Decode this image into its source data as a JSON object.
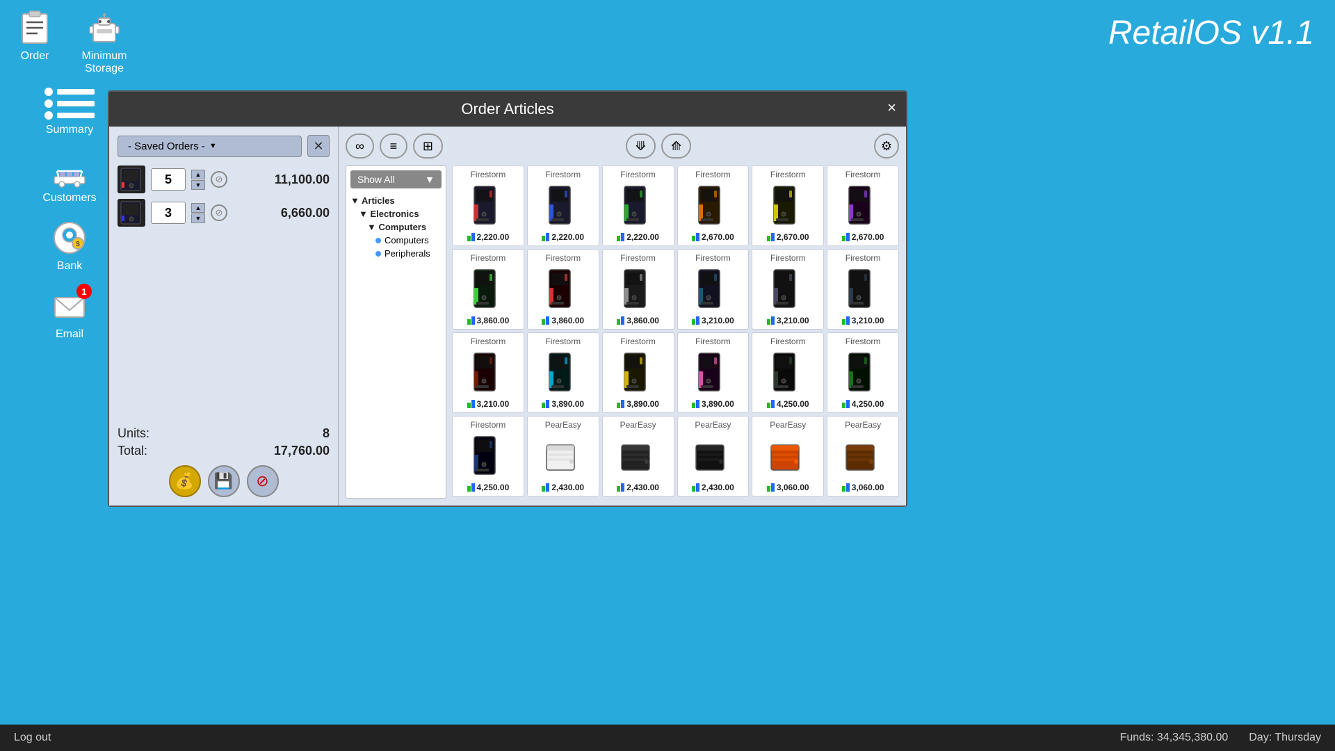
{
  "branding": {
    "title": "RetailOS v1.1"
  },
  "sidebar": {
    "order_label": "Order",
    "min_storage_label": "Minimum\nStorage",
    "summary_label": "Summary",
    "customers_label": "Customers",
    "bank_label": "Bank",
    "email_label": "Email",
    "email_badge": "1"
  },
  "dialog": {
    "title": "Order Articles",
    "close_label": "×",
    "saved_orders_label": "- Saved Orders -",
    "order_rows": [
      {
        "qty": "5",
        "price": "11,100.00"
      },
      {
        "qty": "3",
        "price": "6,660.00"
      }
    ],
    "units_label": "Units:",
    "units_value": "8",
    "total_label": "Total:",
    "total_value": "17,760.00"
  },
  "toolbar": {
    "infinity_label": "∞",
    "list_label": "≡",
    "grid_label": "⊞",
    "filter1_label": "⟱",
    "filter2_label": "⟰",
    "settings_label": "⚙"
  },
  "category": {
    "show_all": "Show All",
    "tree": [
      {
        "label": "Articles",
        "children": [
          {
            "label": "Electronics",
            "children": [
              {
                "label": "Computers",
                "children": [
                  {
                    "label": "Computers",
                    "type": "leaf"
                  },
                  {
                    "label": "Peripherals",
                    "type": "leaf"
                  }
                ]
              }
            ]
          }
        ]
      }
    ]
  },
  "products": [
    {
      "name": "Firestorm",
      "price": "2,220.00",
      "color": "red"
    },
    {
      "name": "Firestorm",
      "price": "2,220.00",
      "color": "blue"
    },
    {
      "name": "Firestorm",
      "price": "2,220.00",
      "color": "green"
    },
    {
      "name": "Firestorm",
      "price": "2,670.00",
      "color": "orange"
    },
    {
      "name": "Firestorm",
      "price": "2,670.00",
      "color": "yellow"
    },
    {
      "name": "Firestorm",
      "price": "2,670.00",
      "color": "purple"
    },
    {
      "name": "Firestorm",
      "price": "3,860.00",
      "color": "green2"
    },
    {
      "name": "Firestorm",
      "price": "3,860.00",
      "color": "red2"
    },
    {
      "name": "Firestorm",
      "price": "3,860.00",
      "color": "gray"
    },
    {
      "name": "Firestorm",
      "price": "3,210.00",
      "color": "dark"
    },
    {
      "name": "Firestorm",
      "price": "3,210.00",
      "color": "dark2"
    },
    {
      "name": "Firestorm",
      "price": "3,210.00",
      "color": "dark3"
    },
    {
      "name": "Firestorm",
      "price": "3,210.00",
      "color": "darkred"
    },
    {
      "name": "Firestorm",
      "price": "3,890.00",
      "color": "cyan"
    },
    {
      "name": "Firestorm",
      "price": "3,890.00",
      "color": "yellow2"
    },
    {
      "name": "Firestorm",
      "price": "3,890.00",
      "color": "pink"
    },
    {
      "name": "Firestorm",
      "price": "4,250.00",
      "color": "dark4"
    },
    {
      "name": "Firestorm",
      "price": "4,250.00",
      "color": "greenDark"
    },
    {
      "name": "Firestorm",
      "price": "4,250.00",
      "color": "blueDark"
    },
    {
      "name": "PearEasy",
      "price": "2,430.00",
      "color": "white"
    },
    {
      "name": "PearEasy",
      "price": "2,430.00",
      "color": "black"
    },
    {
      "name": "PearEasy",
      "price": "2,430.00",
      "color": "black2"
    },
    {
      "name": "PearEasy",
      "price": "3,060.00",
      "color": "orange2"
    },
    {
      "name": "PearEasy",
      "price": "3,060.00",
      "color": "brown"
    }
  ],
  "status_bar": {
    "logout_label": "Log out",
    "funds_label": "Funds: 34,345,380.00",
    "day_label": "Day: Thursday"
  }
}
